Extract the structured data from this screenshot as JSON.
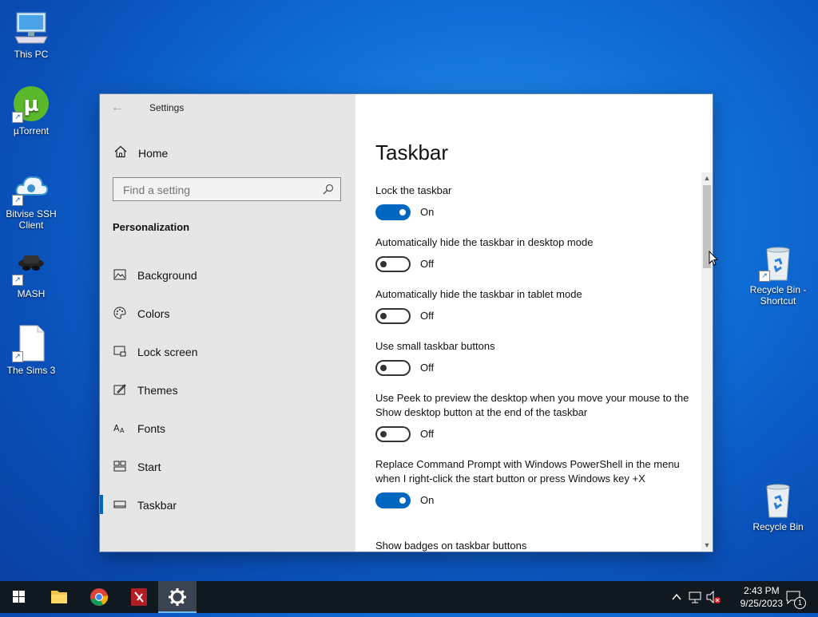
{
  "desktop": {
    "icons": [
      {
        "label": "This PC"
      },
      {
        "label": "µTorrent"
      },
      {
        "label": "Bitvise SSH Client"
      },
      {
        "label": "MASH"
      },
      {
        "label": "The Sims 3"
      },
      {
        "label": "Recycle Bin - Shortcut"
      },
      {
        "label": "Recycle Bin"
      }
    ]
  },
  "window": {
    "title": "Settings",
    "home_label": "Home",
    "search_placeholder": "Find a setting",
    "section": "Personalization",
    "nav_items": [
      {
        "label": "Background",
        "icon": "picture-icon"
      },
      {
        "label": "Colors",
        "icon": "palette-icon"
      },
      {
        "label": "Lock screen",
        "icon": "lock-screen-icon"
      },
      {
        "label": "Themes",
        "icon": "themes-icon"
      },
      {
        "label": "Fonts",
        "icon": "fonts-icon"
      },
      {
        "label": "Start",
        "icon": "start-icon"
      },
      {
        "label": "Taskbar",
        "icon": "taskbar-icon",
        "selected": true
      }
    ],
    "page_title": "Taskbar",
    "settings": [
      {
        "label": "Lock the taskbar",
        "state": "On"
      },
      {
        "label": "Automatically hide the taskbar in desktop mode",
        "state": "Off"
      },
      {
        "label": "Automatically hide the taskbar in tablet mode",
        "state": "Off"
      },
      {
        "label": "Use small taskbar buttons",
        "state": "Off"
      },
      {
        "label": "Use Peek to preview the desktop when you move your mouse to the Show desktop button at the end of the taskbar",
        "state": "Off"
      },
      {
        "label": "Replace Command Prompt with Windows PowerShell in the menu when I right-click the start button or press Windows key +X",
        "state": "On"
      },
      {
        "label": "Show badges on taskbar buttons"
      }
    ],
    "accent_color": "#0067c0"
  },
  "taskbar": {
    "time": "2:43 PM",
    "date": "9/25/2023",
    "notification_count": "1"
  }
}
